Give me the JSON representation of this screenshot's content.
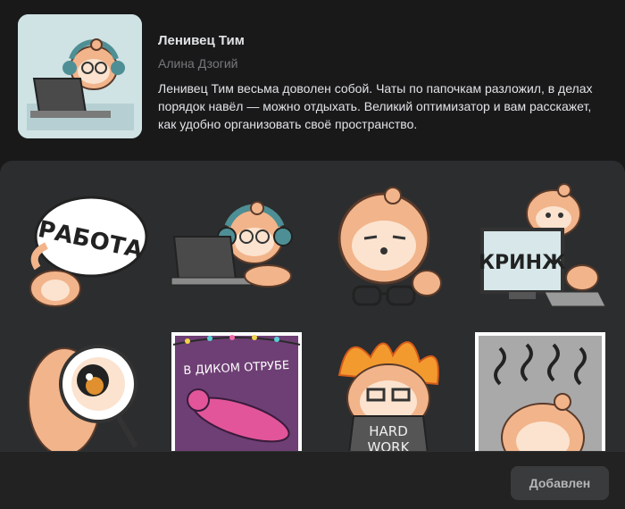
{
  "pack": {
    "title": "Ленивец Тим",
    "author": "Алина Дзогий",
    "description": "Ленивец Тим весьма доволен собой. Чаты по папочкам разложил, в делах порядок навёл — можно отдыхать. Великий оптимизатор и вам расскажет, как удобно организовать своё пространство."
  },
  "stickers": [
    {
      "caption": "РАБОТА"
    },
    {
      "caption": ""
    },
    {
      "caption": ""
    },
    {
      "caption": "КРИНЖ"
    },
    {
      "caption": ""
    },
    {
      "caption": "В ДИКОМ ОТРУБЕ"
    },
    {
      "caption_line1": "HARD",
      "caption_line2": "WORK"
    },
    {
      "caption": ""
    }
  ],
  "footer": {
    "button_label": "Добавлен"
  },
  "colors": {
    "background": "#19191a",
    "panel": "#2c2d2e",
    "sloth_fur": "#f2b48a",
    "accent_teal": "#4e8f95"
  }
}
